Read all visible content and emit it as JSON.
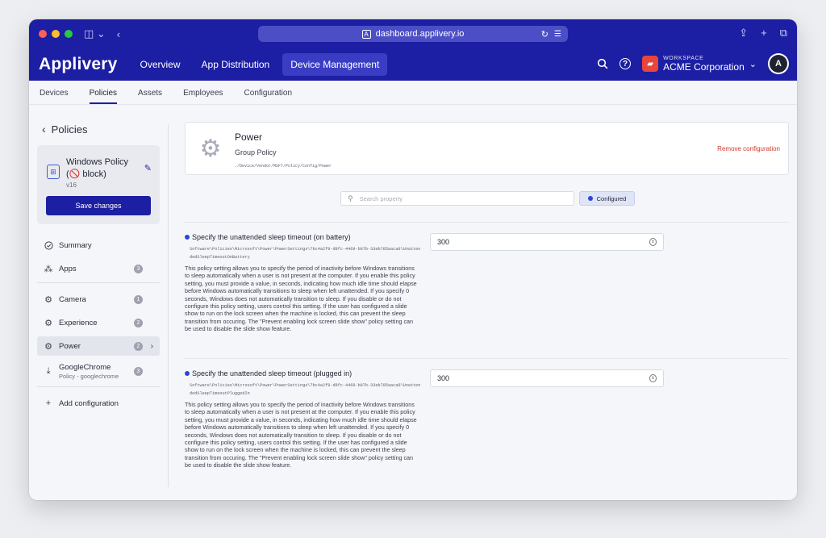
{
  "browser": {
    "url": "dashboard.applivery.io"
  },
  "app": {
    "logo": "Applivery",
    "nav": [
      "Overview",
      "App Distribution",
      "Device Management"
    ],
    "workspace_label": "WORKSPACE",
    "workspace_name": "ACME Corporation"
  },
  "subnav": [
    "Devices",
    "Policies",
    "Assets",
    "Employees",
    "Configuration"
  ],
  "sidebar": {
    "back_label": "Policies",
    "policy_name_line1": "Windows Policy",
    "policy_name_line2": "(🚫 block)",
    "policy_version": "v16",
    "save_label": "Save changes",
    "items": [
      {
        "label": "Summary",
        "icon": "check-circle-icon"
      },
      {
        "label": "Apps",
        "count": "3",
        "icon": "apps-icon"
      },
      {
        "label": "Camera",
        "count": "1",
        "icon": "gear-icon"
      },
      {
        "label": "Experience",
        "count": "2",
        "icon": "gear-icon"
      },
      {
        "label": "Power",
        "count": "2",
        "icon": "gear-icon"
      },
      {
        "label": "GoogleChrome",
        "sub": "Policy - googlechrome",
        "count": "3",
        "icon": "download-icon"
      }
    ],
    "add_label": "Add configuration"
  },
  "config": {
    "title": "Power",
    "subtitle": "Group Policy",
    "path": "./Device/Vendor/MSFT/Policy/Config/Power",
    "remove_label": "Remove configuration"
  },
  "search": {
    "placeholder": "Search property",
    "filter_label": "Configured"
  },
  "settings": [
    {
      "title": "Specify the unattended sleep timeout (on battery)",
      "path": "Software\\Policies\\Microsoft\\Power\\PowerSettings\\7bc4a2f9-d8fc-4469-b07b-33eb785aaca0\\UnattendedSleepTimeoutOnBattery",
      "description": "This policy setting allows you to specify the period of inactivity before Windows transitions to sleep automatically when a user is not present at the computer. If you enable this policy setting, you must provide a value, in seconds, indicating how much idle time should elapse before Windows automatically transitions to sleep when left unattended. If you specify 0 seconds, Windows does not automatically transition to sleep. If you disable or do not configure this policy setting, users control this setting. If the user has configured a slide show to run on the lock screen when the machine is locked, this can prevent the sleep transition from occuring. The \"Prevent enabling lock screen slide show\" policy setting can be used to disable the slide show feature.",
      "value": "300"
    },
    {
      "title": "Specify the unattended sleep timeout (plugged in)",
      "path": "Software\\Policies\\Microsoft\\Power\\PowerSettings\\7bc4a2f9-d8fc-4469-b07b-33eb785aaca0\\UnattendedSleepTimeoutPluggedIn",
      "description": "This policy setting allows you to specify the period of inactivity before Windows transitions to sleep automatically when a user is not present at the computer. If you enable this policy setting, you must provide a value, in seconds, indicating how much idle time should elapse before Windows automatically transitions to sleep when left unattended. If you specify 0 seconds, Windows does not automatically transition to sleep. If you disable or do not configure this policy setting, users control this setting. If the user has configured a slide show to run on the lock screen when the machine is locked, this can prevent the sleep transition from occuring. The \"Prevent enabling lock screen slide show\" policy setting can be used to disable the slide show feature.",
      "value": "300"
    }
  ],
  "colors": {
    "brand": "#1c1ea3",
    "accent_dot": "#2b46d9",
    "danger": "#d0392b"
  }
}
